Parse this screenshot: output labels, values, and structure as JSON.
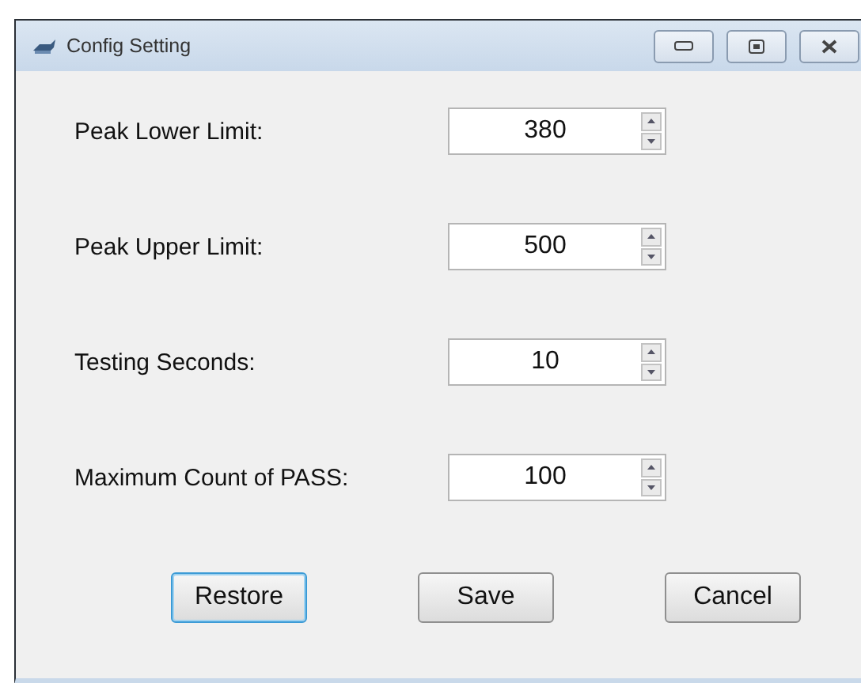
{
  "window": {
    "title": "Config Setting"
  },
  "fields": [
    {
      "label": "Peak Lower Limit:",
      "value": "380"
    },
    {
      "label": "Peak Upper Limit:",
      "value": "500"
    },
    {
      "label": "Testing Seconds:",
      "value": "10"
    },
    {
      "label": "Maximum Count of PASS:",
      "value": "100"
    }
  ],
  "buttons": [
    {
      "label": "Restore",
      "focused": true
    },
    {
      "label": "Save",
      "focused": false
    },
    {
      "label": "Cancel",
      "focused": false
    }
  ]
}
